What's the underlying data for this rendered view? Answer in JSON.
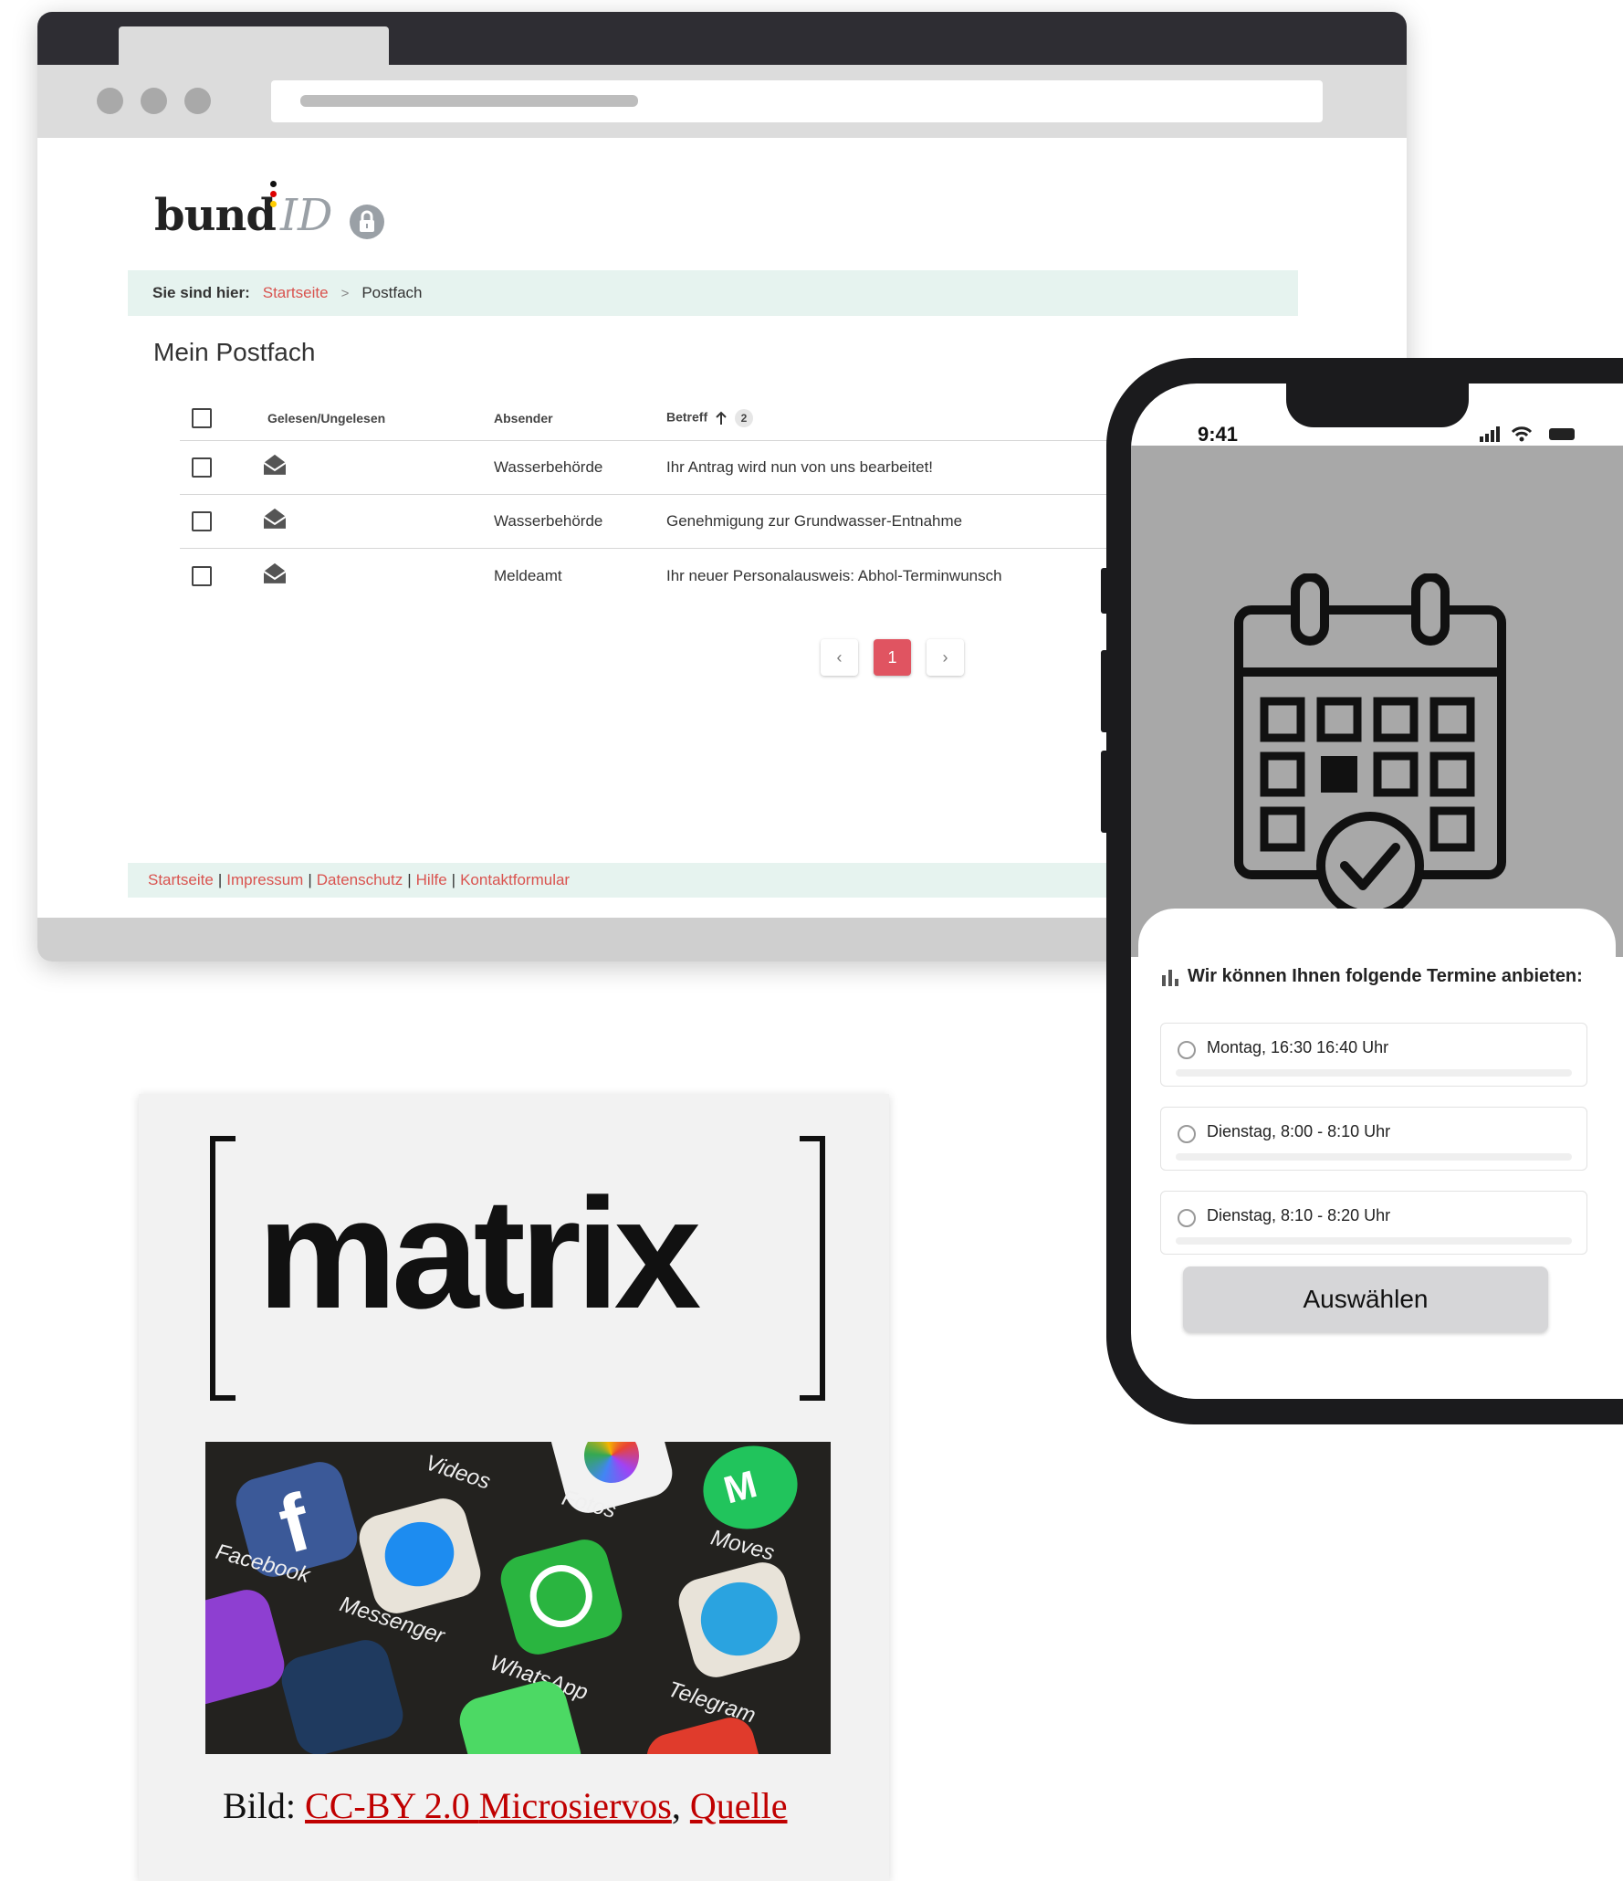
{
  "browser": {
    "logo": {
      "word": "bund",
      "suffix": "ID"
    },
    "breadcrumb": {
      "prefix": "Sie sind hier:",
      "home": "Startseite",
      "separator": ">",
      "current": "Postfach"
    },
    "page_title": "Mein Postfach",
    "table": {
      "headers": {
        "read_status": "Gelesen/Ungelesen",
        "sender": "Absender",
        "subject": "Betreff",
        "sort_badge": "2"
      },
      "rows": [
        {
          "sender": "Wasserbehörde",
          "subject": "Ihr Antrag wird nun von uns bearbeitet!"
        },
        {
          "sender": "Wasserbehörde",
          "subject": "Genehmigung zur Grundwasser-Entnahme"
        },
        {
          "sender": "Meldeamt",
          "subject": "Ihr neuer Personalausweis: Abhol-Terminwunsch"
        }
      ]
    },
    "pagination": {
      "prev": "‹",
      "current_page": "1",
      "next": "›"
    },
    "footer_links": [
      "Startseite",
      "Impressum",
      "Datenschutz",
      "Hilfe",
      "Kontaktformular"
    ],
    "footer_separator": "|",
    "colors": {
      "accent": "#e05461",
      "link": "#d9534f",
      "band": "#e6f3ef"
    }
  },
  "phone": {
    "status_time": "9:41",
    "poll": {
      "title": "Wir können Ihnen folgende Termine anbieten:",
      "options": [
        "Montag, 16:30 16:40 Uhr",
        "Dienstag, 8:00 - 8:10 Uhr",
        "Dienstag, 8:10 - 8:20 Uhr"
      ],
      "button": "Auswählen"
    }
  },
  "matrix_card": {
    "logo_text": "matrix",
    "photo_apps": [
      {
        "label": "Facebook",
        "icon": "facebook-icon"
      },
      {
        "label": "Messenger",
        "icon": "messenger-icon"
      },
      {
        "label": "Videos",
        "icon": "videos-icon"
      },
      {
        "label": "Fotos",
        "icon": "photos-icon"
      },
      {
        "label": "WhatsApp",
        "icon": "whatsapp-icon"
      },
      {
        "label": "Moves",
        "icon": "moves-icon"
      },
      {
        "label": "Telegram",
        "icon": "telegram-icon"
      }
    ],
    "caption": {
      "prefix": "Bild: ",
      "license": "CC-BY 2.0 ",
      "author": "Microsiervos",
      "separator": ", ",
      "source": "Quelle"
    }
  }
}
